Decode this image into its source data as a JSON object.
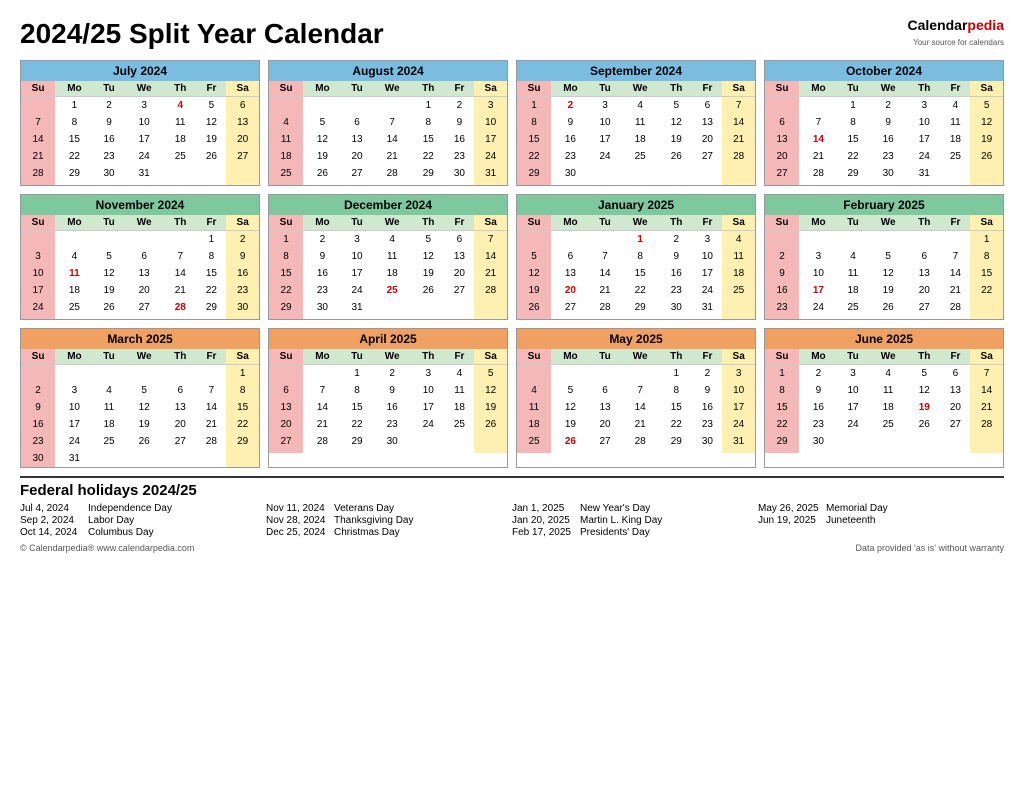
{
  "title": "2024/25 Split Year Calendar",
  "logo": {
    "name1": "Calendar",
    "name2": "pedia",
    "tagline": "Your source for calendars"
  },
  "months": [
    {
      "name": "July 2024",
      "headerClass": "blue",
      "startDay": 1,
      "days": 31,
      "holidays": [
        4
      ],
      "weekStartDay": 1
    },
    {
      "name": "August 2024",
      "headerClass": "blue",
      "startDay": 4,
      "days": 31,
      "holidays": [],
      "weekStartDay": 4
    },
    {
      "name": "September 2024",
      "headerClass": "blue",
      "startDay": 0,
      "days": 30,
      "holidays": [
        2
      ],
      "weekStartDay": 0
    },
    {
      "name": "October 2024",
      "headerClass": "blue",
      "startDay": 2,
      "days": 31,
      "holidays": [
        14
      ],
      "weekStartDay": 2
    },
    {
      "name": "November 2024",
      "headerClass": "",
      "startDay": 5,
      "days": 30,
      "holidays": [
        11,
        28
      ],
      "weekStartDay": 5
    },
    {
      "name": "December 2024",
      "headerClass": "",
      "startDay": 0,
      "days": 31,
      "holidays": [
        25
      ],
      "weekStartDay": 0
    },
    {
      "name": "January 2025",
      "headerClass": "",
      "startDay": 3,
      "days": 31,
      "holidays": [
        1,
        20
      ],
      "weekStartDay": 3
    },
    {
      "name": "February 2025",
      "headerClass": "",
      "startDay": 6,
      "days": 28,
      "holidays": [
        17
      ],
      "weekStartDay": 6
    },
    {
      "name": "March 2025",
      "headerClass": "orange",
      "startDay": 6,
      "days": 31,
      "holidays": [],
      "weekStartDay": 6
    },
    {
      "name": "April 2025",
      "headerClass": "orange",
      "startDay": 2,
      "days": 30,
      "holidays": [],
      "weekStartDay": 2
    },
    {
      "name": "May 2025",
      "headerClass": "orange",
      "startDay": 4,
      "days": 31,
      "holidays": [
        26
      ],
      "weekStartDay": 4
    },
    {
      "name": "June 2025",
      "headerClass": "orange",
      "startDay": 0,
      "days": 30,
      "holidays": [
        19
      ],
      "weekStartDay": 0
    }
  ],
  "holidays": {
    "col1": [
      {
        "date": "Jul 4, 2024",
        "name": "Independence Day"
      },
      {
        "date": "Sep 2, 2024",
        "name": "Labor Day"
      },
      {
        "date": "Oct 14, 2024",
        "name": "Columbus Day"
      }
    ],
    "col2": [
      {
        "date": "Nov 11, 2024",
        "name": "Veterans Day"
      },
      {
        "date": "Nov 28, 2024",
        "name": "Thanksgiving Day"
      },
      {
        "date": "Dec 25, 2024",
        "name": "Christmas Day"
      }
    ],
    "col3": [
      {
        "date": "Jan 1, 2025",
        "name": "New Year's Day"
      },
      {
        "date": "Jan 20, 2025",
        "name": "Martin L. King Day"
      },
      {
        "date": "Feb 17, 2025",
        "name": "Presidents' Day"
      }
    ],
    "col4": [
      {
        "date": "May 26, 2025",
        "name": "Memorial Day"
      },
      {
        "date": "Jun 19, 2025",
        "name": "Juneteenth"
      }
    ]
  },
  "footer": {
    "left": "© Calendarpedia®   www.calendarpedia.com",
    "right": "Data provided 'as is' without warranty"
  }
}
